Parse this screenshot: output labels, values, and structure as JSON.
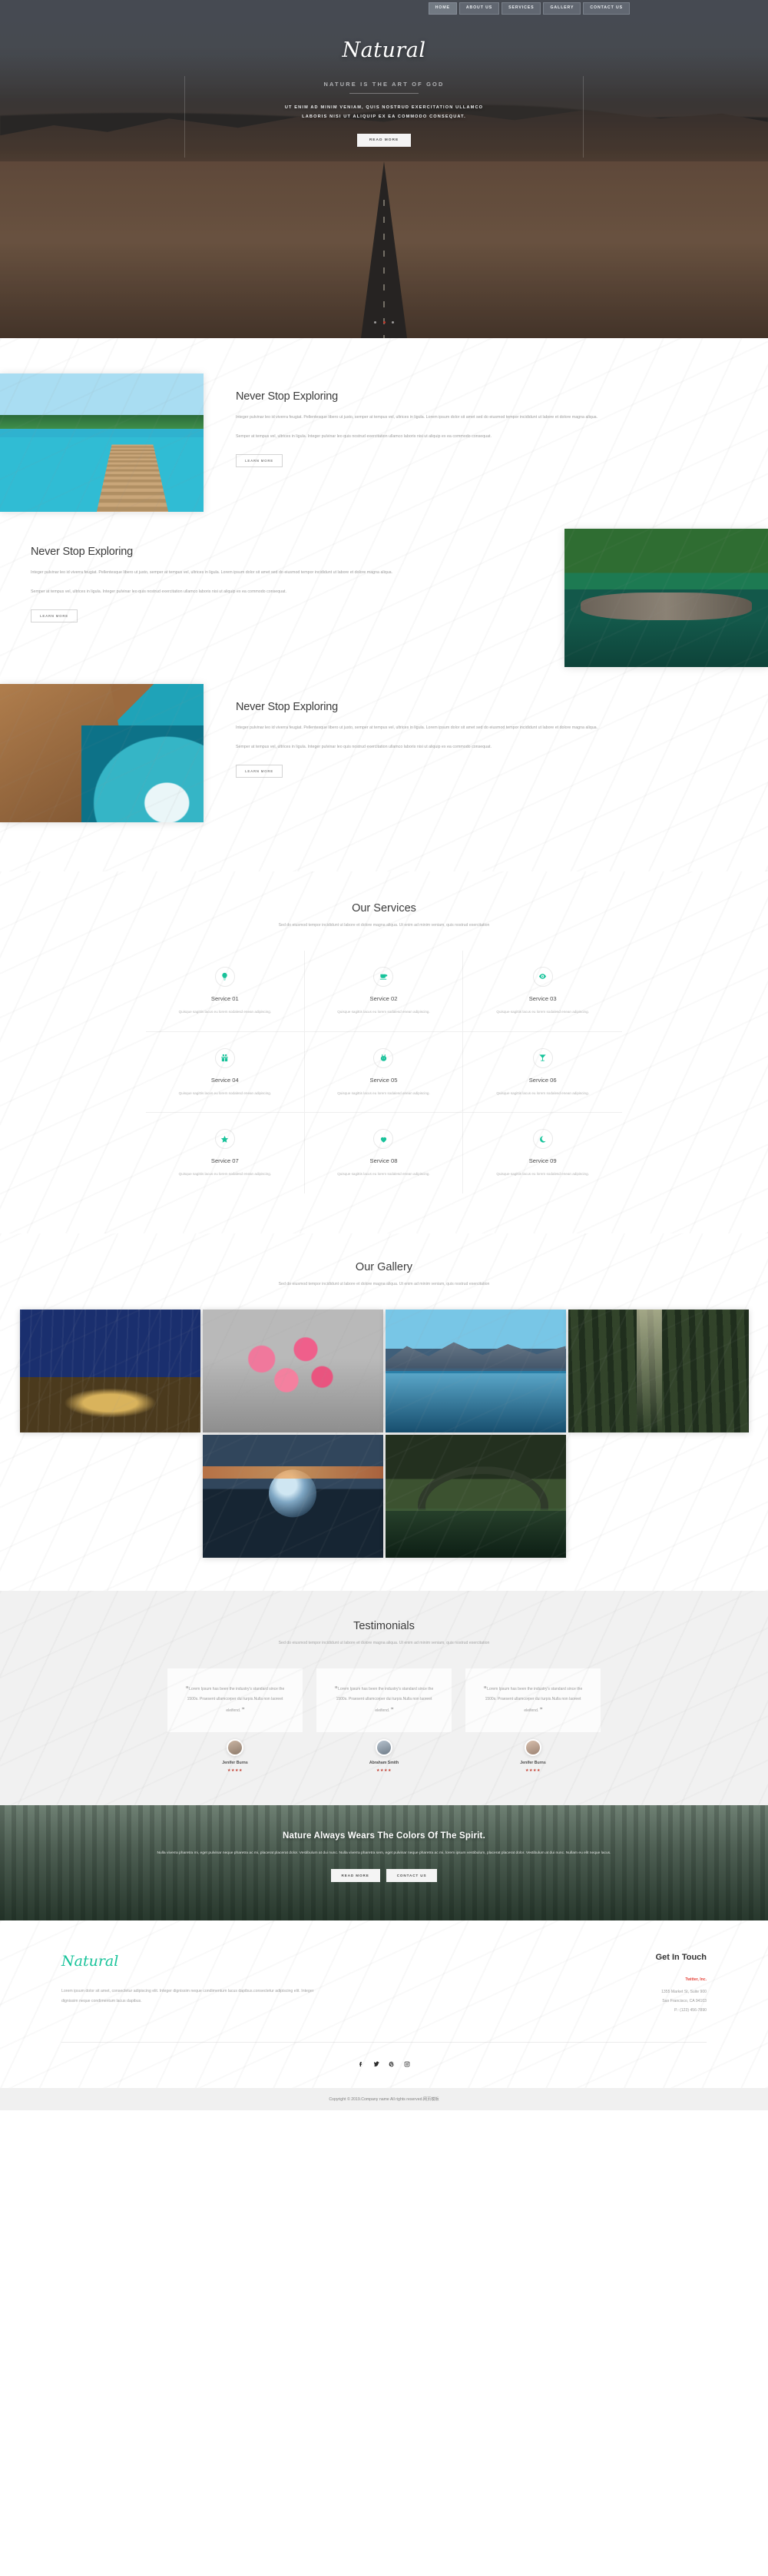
{
  "nav": {
    "items": [
      {
        "label": "HOME",
        "active": true
      },
      {
        "label": "ABOUT US",
        "active": false
      },
      {
        "label": "SERVICES",
        "active": false
      },
      {
        "label": "GALLERY",
        "active": false
      },
      {
        "label": "CONTACT US",
        "active": false
      }
    ]
  },
  "hero": {
    "brand": "Natural",
    "tagline": "NATURE IS THE ART OF GOD",
    "subtitle_line1": "UT ENIM AD MINIM VENIAM, QUIS NOSTRUD EXERCITATION ULLAMCO",
    "subtitle_line2": "LABORIS NISI UT ALIQUIP EX EA COMMODO CONSEQUAT.",
    "button": "READ MORE"
  },
  "explore": {
    "learn_more": "LEARN MORE",
    "rows": [
      {
        "heading": "Never Stop Exploring",
        "p1": "Integer pulvinar leo id viverra feugiat. Pellentesque libero ut justo, semper at tempus vel, ultrices in ligula. Lorem ipsum dolor sit amet sed do eiusmod tempor incididunt ut labore et dolore magna aliqua.",
        "p2": "Semper at tempus vel, ultrices in ligula. Integer pulvinar leo quis nostrud exercitation ullamco laboris nisi ut aliquip ex ea commodo consequat.",
        "image": "tropical-pier-photo"
      },
      {
        "heading": "Never Stop Exploring",
        "p1": "Integer pulvinar leo id viverra feugiat. Pellentesque libero ut justo, semper at tempus vel, ultrices in ligula. Lorem ipsum dolor sit amet sed do eiusmod tempor incididunt ut labore et dolore magna aliqua.",
        "p2": "Semper at tempus vel, ultrices in ligula. Integer pulvinar leo quis nostrud exercitation ullamco laboris nisi ut aliquip ex ea commodo consequat.",
        "image": "garden-pond-photo"
      },
      {
        "heading": "Never Stop Exploring",
        "p1": "Integer pulvinar leo id viverra feugiat. Pellentesque libero ut justo, semper at tempus vel, ultrices in ligula. Lorem ipsum dolor sit amet sed do eiusmod tempor incididunt ut labore et dolore magna aliqua.",
        "p2": "Semper at tempus vel, ultrices in ligula. Integer pulvinar leo quis nostrud exercitation ullamco laboris nisi ut aliquip ex ea commodo consequat.",
        "image": "rocky-coast-photo"
      }
    ]
  },
  "services": {
    "heading": "Our Services",
    "subheading": "Sed do eiusmod tempor incididunt ut labore et dolore magna aliqua. Ut enim ad minim veniam, quis nostrud exercitation",
    "items": [
      {
        "title": "Service 01",
        "desc": "Quisque sagittis lacus eu lorem sodalesd enean adipiscing.",
        "icon": "lightbulb-icon"
      },
      {
        "title": "Service 02",
        "desc": "Quisque sagittis lacus eu lorem sodalesd enean adipiscing.",
        "icon": "coffee-cup-icon"
      },
      {
        "title": "Service 03",
        "desc": "Quisque sagittis lacus eu lorem sodalesd enean adipiscing.",
        "icon": "eye-icon"
      },
      {
        "title": "Service 04",
        "desc": "Quisque sagittis lacus eu lorem sodalesd enean adipiscing.",
        "icon": "gift-icon"
      },
      {
        "title": "Service 05",
        "desc": "Quisque sagittis lacus eu lorem sodalesd enean adipiscing.",
        "icon": "rabbit-icon"
      },
      {
        "title": "Service 06",
        "desc": "Quisque sagittis lacus eu lorem sodalesd enean adipiscing.",
        "icon": "cocktail-glass-icon"
      },
      {
        "title": "Service 07",
        "desc": "Quisque sagittis lacus eu lorem sodalesd enean adipiscing.",
        "icon": "star-icon"
      },
      {
        "title": "Service 08",
        "desc": "Quisque sagittis lacus eu lorem sodalesd enean adipiscing.",
        "icon": "heart-icon"
      },
      {
        "title": "Service 09",
        "desc": "Quisque sagittis lacus eu lorem sodalesd enean adipiscing.",
        "icon": "moon-icon"
      }
    ]
  },
  "gallery": {
    "heading": "Our Gallery",
    "subheading": "Sed do eiusmod tempor incididunt ut labore et dolore magna aliqua. Ut enim ad minim veniam, quis nostrud exercitation",
    "items": [
      {
        "name": "blue-forest-photo"
      },
      {
        "name": "pink-blossom-photo"
      },
      {
        "name": "mountain-lake-photo"
      },
      {
        "name": "sunbeam-forest-photo"
      },
      {
        "name": "crystal-ball-sunset-photo"
      },
      {
        "name": "stone-arch-bridge-photo"
      }
    ]
  },
  "testimonials": {
    "heading": "Testimonials",
    "subheading": "Sed do eiusmod tempor incididunt ut labore et dolore magna aliqua. Ut enim ad minim veniam, quis nostrud exercitation",
    "quote_open": "“",
    "quote_close": "”",
    "items": [
      {
        "quote": "Lorem Ipsum has been the industry's standard since the 1500s. Praesent ullamcorper dui turpis.Nulla non laoreet eleifend.",
        "name": "Jenifer Burns",
        "stars": "★★★★"
      },
      {
        "quote": "Lorem Ipsum has been the industry's standard since the 1500s. Praesent ullamcorper dui turpis.Nulla non laoreet eleifend.",
        "name": "Abraham Smith",
        "stars": "★★★★"
      },
      {
        "quote": "Lorem Ipsum has been the industry's standard since the 1500s. Praesent ullamcorper dui turpis.Nulla non laoreet eleifend.",
        "name": "Jenifer Burns",
        "stars": "★★★★"
      }
    ]
  },
  "cta": {
    "heading": "Nature Always Wears The Colors Of The Spirit.",
    "text": "Nulla viverra pharetra mi, eget pulvinar neque pharetra ac mi, placerat placerat dolor. Vestibulum at dui nunc. Nulla viverra pharetra sem, eget pulvinar neque pharetra ac mi, lorem ipsum vestibulum, placerat placerat dolor. Vestibulum at dui nunc. Nullam eu elit neque lacus.",
    "btn_read": "READ MORE",
    "btn_contact": "CONTACT US"
  },
  "footer": {
    "logo": "Natural",
    "about": "Lorem ipsum dolor sit amet, consectetur adipiscing elit. Integer dignissim neque condimentum lacus dapibus.consectetur adipiscing elit. Integer dignissim neque condimentum lacus dapibus.",
    "contact_heading": "Get In Touch",
    "company": "Twitter, Inc.",
    "address1": "1355 Market St, Suite 900",
    "address2": "San Francisco, CA 94103",
    "phone": "P.: (123) 456-7890",
    "social": [
      "facebook-icon",
      "twitter-icon",
      "pinterest-icon",
      "instagram-icon"
    ],
    "copyright": "Copyright © 2019.Company name All rights reserved.网页模板"
  },
  "colors": {
    "accent": "#15c39a",
    "star": "#c0392b",
    "company_red": "#e5433a"
  }
}
